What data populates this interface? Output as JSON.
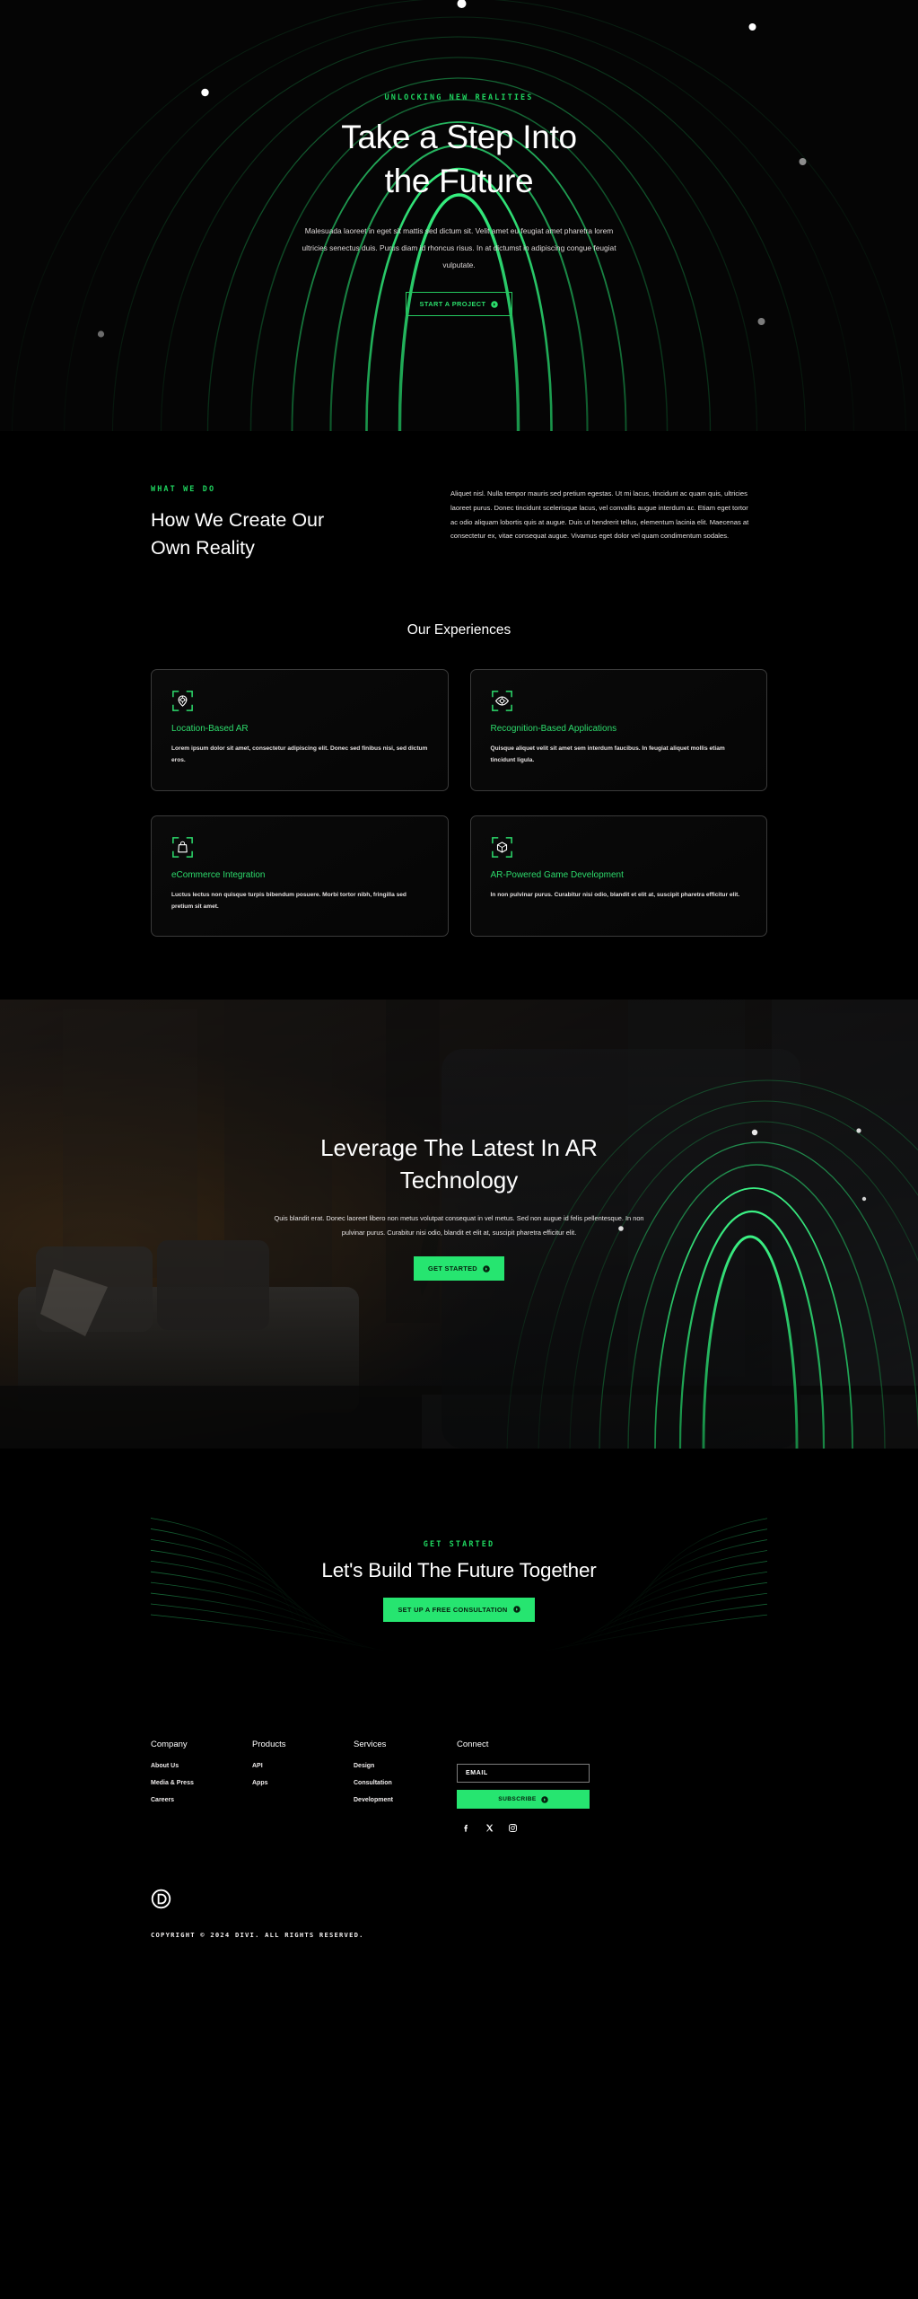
{
  "hero": {
    "eyebrow": "UNLOCKING NEW REALITIES",
    "title_line1": "Take a Step Into",
    "title_line2": "the Future",
    "paragraph": "Malesuada laoreet in eget sit mattis sed dictum sit. Velit amet eu feugiat amet pharetra lorem ultricies senectus duis. Purus diam id rhoncus risus. In at dictumst in adipiscing congue feugiat vulputate.",
    "cta_label": "START A PROJECT"
  },
  "what_we_do": {
    "eyebrow": "WHAT WE DO",
    "title_line1": "How We Create Our",
    "title_line2": "Own Reality",
    "paragraph": "Aliquet nisl. Nulla tempor mauris sed pretium egestas. Ut mi lacus, tincidunt ac quam quis, ultricies laoreet purus. Donec tincidunt scelerisque lacus, vel convallis augue interdum ac. Etiam eget tortor ac odio aliquam lobortis quis at augue. Duis ut hendrerit tellus, elementum lacinia elit. Maecenas at consectetur ex, vitae consequat augue. Vivamus eget dolor vel quam condimentum sodales."
  },
  "experiences": {
    "heading": "Our Experiences",
    "cards": [
      {
        "icon": "location-pin-scan-icon",
        "title": "Location-Based AR",
        "desc": "Lorem ipsum dolor sit amet, consectetur adipiscing elit. Donec sed finibus nisi, sed dictum eros."
      },
      {
        "icon": "eye-scan-icon",
        "title": "Recognition-Based Applications",
        "desc": "Quisque aliquet velit sit amet sem interdum faucibus. In feugiat aliquet mollis etiam tincidunt ligula."
      },
      {
        "icon": "shopping-bag-scan-icon",
        "title": "eCommerce Integration",
        "desc": "Luctus lectus non quisque turpis bibendum posuere. Morbi tortor nibh, fringilla sed pretium sit amet."
      },
      {
        "icon": "cube-scan-icon",
        "title": "AR-Powered Game Development",
        "desc": "In non pulvinar purus. Curabitur nisi odio, blandit et elit at, suscipit pharetra efficitur elit."
      }
    ]
  },
  "ar_section": {
    "title_line1": "Leverage The Latest In AR",
    "title_line2": "Technology",
    "paragraph": "Quis blandit erat. Donec laoreet libero non metus volutpat consequat in vel metus. Sed non augue id felis pellentesque. In non pulvinar purus. Curabitur nisi odio, blandit et elit at, suscipit pharetra efficitur elit.",
    "cta_label": "GET STARTED"
  },
  "cta_panel": {
    "eyebrow": "GET STARTED",
    "title": "Let's Build The Future Together",
    "cta_label": "SET UP A FREE CONSULTATION"
  },
  "footer": {
    "columns": [
      {
        "title": "Company",
        "links": [
          "About Us",
          "Media & Press",
          "Careers"
        ]
      },
      {
        "title": "Products",
        "links": [
          "API",
          "Apps"
        ]
      },
      {
        "title": "Services",
        "links": [
          "Design",
          "Consultation",
          "Development"
        ]
      }
    ],
    "connect": {
      "title": "Connect",
      "email_placeholder": "EMAIL",
      "email_value": "",
      "subscribe_label": "SUBSCRIBE",
      "socials": [
        "facebook-icon",
        "x-twitter-icon",
        "instagram-icon"
      ]
    },
    "logo": "divi-logo-icon",
    "copyright": "COPYRIGHT © 2024 DIVI. ALL RIGHTS RESERVED."
  },
  "colors": {
    "accent_green": "#26e570",
    "accent_green_text": "#2ddb6c",
    "eyebrow_green": "#1fd45f",
    "background": "#000000",
    "card_border": "#3a3a3a"
  }
}
